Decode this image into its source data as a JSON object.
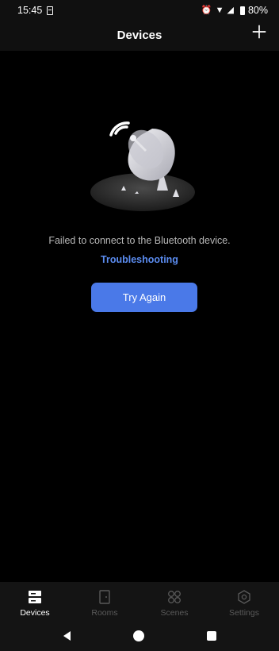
{
  "status": {
    "time": "15:45",
    "battery": "80%"
  },
  "appbar": {
    "title": "Devices",
    "add_icon": "plus-icon"
  },
  "main": {
    "message": "Failed to connect to the Bluetooth device.",
    "troubleshoot": "Troubleshooting",
    "try_again": "Try Again",
    "accent": "#4a79e8"
  },
  "tabs": [
    {
      "label": "Devices",
      "icon": "devices-icon",
      "active": true
    },
    {
      "label": "Rooms",
      "icon": "rooms-icon",
      "active": false
    },
    {
      "label": "Scenes",
      "icon": "scenes-icon",
      "active": false
    },
    {
      "label": "Settings",
      "icon": "settings-icon",
      "active": false
    }
  ]
}
